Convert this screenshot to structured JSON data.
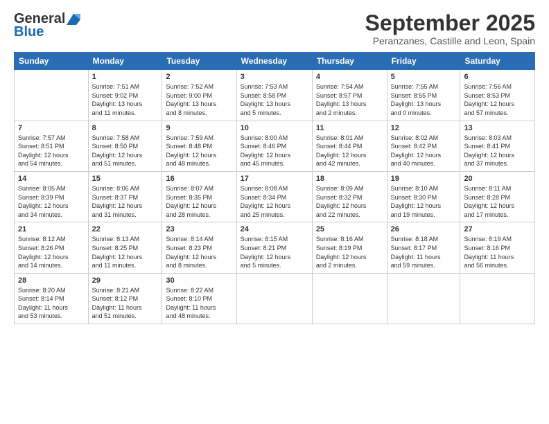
{
  "logo": {
    "general": "General",
    "blue": "Blue"
  },
  "title": "September 2025",
  "location": "Peranzanes, Castille and Leon, Spain",
  "days_header": [
    "Sunday",
    "Monday",
    "Tuesday",
    "Wednesday",
    "Thursday",
    "Friday",
    "Saturday"
  ],
  "weeks": [
    [
      {
        "num": "",
        "info": ""
      },
      {
        "num": "1",
        "info": "Sunrise: 7:51 AM\nSunset: 9:02 PM\nDaylight: 13 hours\nand 11 minutes."
      },
      {
        "num": "2",
        "info": "Sunrise: 7:52 AM\nSunset: 9:00 PM\nDaylight: 13 hours\nand 8 minutes."
      },
      {
        "num": "3",
        "info": "Sunrise: 7:53 AM\nSunset: 8:58 PM\nDaylight: 13 hours\nand 5 minutes."
      },
      {
        "num": "4",
        "info": "Sunrise: 7:54 AM\nSunset: 8:57 PM\nDaylight: 13 hours\nand 2 minutes."
      },
      {
        "num": "5",
        "info": "Sunrise: 7:55 AM\nSunset: 8:55 PM\nDaylight: 13 hours\nand 0 minutes."
      },
      {
        "num": "6",
        "info": "Sunrise: 7:56 AM\nSunset: 8:53 PM\nDaylight: 12 hours\nand 57 minutes."
      }
    ],
    [
      {
        "num": "7",
        "info": "Sunrise: 7:57 AM\nSunset: 8:51 PM\nDaylight: 12 hours\nand 54 minutes."
      },
      {
        "num": "8",
        "info": "Sunrise: 7:58 AM\nSunset: 8:50 PM\nDaylight: 12 hours\nand 51 minutes."
      },
      {
        "num": "9",
        "info": "Sunrise: 7:59 AM\nSunset: 8:48 PM\nDaylight: 12 hours\nand 48 minutes."
      },
      {
        "num": "10",
        "info": "Sunrise: 8:00 AM\nSunset: 8:46 PM\nDaylight: 12 hours\nand 45 minutes."
      },
      {
        "num": "11",
        "info": "Sunrise: 8:01 AM\nSunset: 8:44 PM\nDaylight: 12 hours\nand 42 minutes."
      },
      {
        "num": "12",
        "info": "Sunrise: 8:02 AM\nSunset: 8:42 PM\nDaylight: 12 hours\nand 40 minutes."
      },
      {
        "num": "13",
        "info": "Sunrise: 8:03 AM\nSunset: 8:41 PM\nDaylight: 12 hours\nand 37 minutes."
      }
    ],
    [
      {
        "num": "14",
        "info": "Sunrise: 8:05 AM\nSunset: 8:39 PM\nDaylight: 12 hours\nand 34 minutes."
      },
      {
        "num": "15",
        "info": "Sunrise: 8:06 AM\nSunset: 8:37 PM\nDaylight: 12 hours\nand 31 minutes."
      },
      {
        "num": "16",
        "info": "Sunrise: 8:07 AM\nSunset: 8:35 PM\nDaylight: 12 hours\nand 28 minutes."
      },
      {
        "num": "17",
        "info": "Sunrise: 8:08 AM\nSunset: 8:34 PM\nDaylight: 12 hours\nand 25 minutes."
      },
      {
        "num": "18",
        "info": "Sunrise: 8:09 AM\nSunset: 8:32 PM\nDaylight: 12 hours\nand 22 minutes."
      },
      {
        "num": "19",
        "info": "Sunrise: 8:10 AM\nSunset: 8:30 PM\nDaylight: 12 hours\nand 19 minutes."
      },
      {
        "num": "20",
        "info": "Sunrise: 8:11 AM\nSunset: 8:28 PM\nDaylight: 12 hours\nand 17 minutes."
      }
    ],
    [
      {
        "num": "21",
        "info": "Sunrise: 8:12 AM\nSunset: 8:26 PM\nDaylight: 12 hours\nand 14 minutes."
      },
      {
        "num": "22",
        "info": "Sunrise: 8:13 AM\nSunset: 8:25 PM\nDaylight: 12 hours\nand 11 minutes."
      },
      {
        "num": "23",
        "info": "Sunrise: 8:14 AM\nSunset: 8:23 PM\nDaylight: 12 hours\nand 8 minutes."
      },
      {
        "num": "24",
        "info": "Sunrise: 8:15 AM\nSunset: 8:21 PM\nDaylight: 12 hours\nand 5 minutes."
      },
      {
        "num": "25",
        "info": "Sunrise: 8:16 AM\nSunset: 8:19 PM\nDaylight: 12 hours\nand 2 minutes."
      },
      {
        "num": "26",
        "info": "Sunrise: 8:18 AM\nSunset: 8:17 PM\nDaylight: 11 hours\nand 59 minutes."
      },
      {
        "num": "27",
        "info": "Sunrise: 8:19 AM\nSunset: 8:16 PM\nDaylight: 11 hours\nand 56 minutes."
      }
    ],
    [
      {
        "num": "28",
        "info": "Sunrise: 8:20 AM\nSunset: 8:14 PM\nDaylight: 11 hours\nand 53 minutes."
      },
      {
        "num": "29",
        "info": "Sunrise: 8:21 AM\nSunset: 8:12 PM\nDaylight: 11 hours\nand 51 minutes."
      },
      {
        "num": "30",
        "info": "Sunrise: 8:22 AM\nSunset: 8:10 PM\nDaylight: 11 hours\nand 48 minutes."
      },
      {
        "num": "",
        "info": ""
      },
      {
        "num": "",
        "info": ""
      },
      {
        "num": "",
        "info": ""
      },
      {
        "num": "",
        "info": ""
      }
    ]
  ]
}
